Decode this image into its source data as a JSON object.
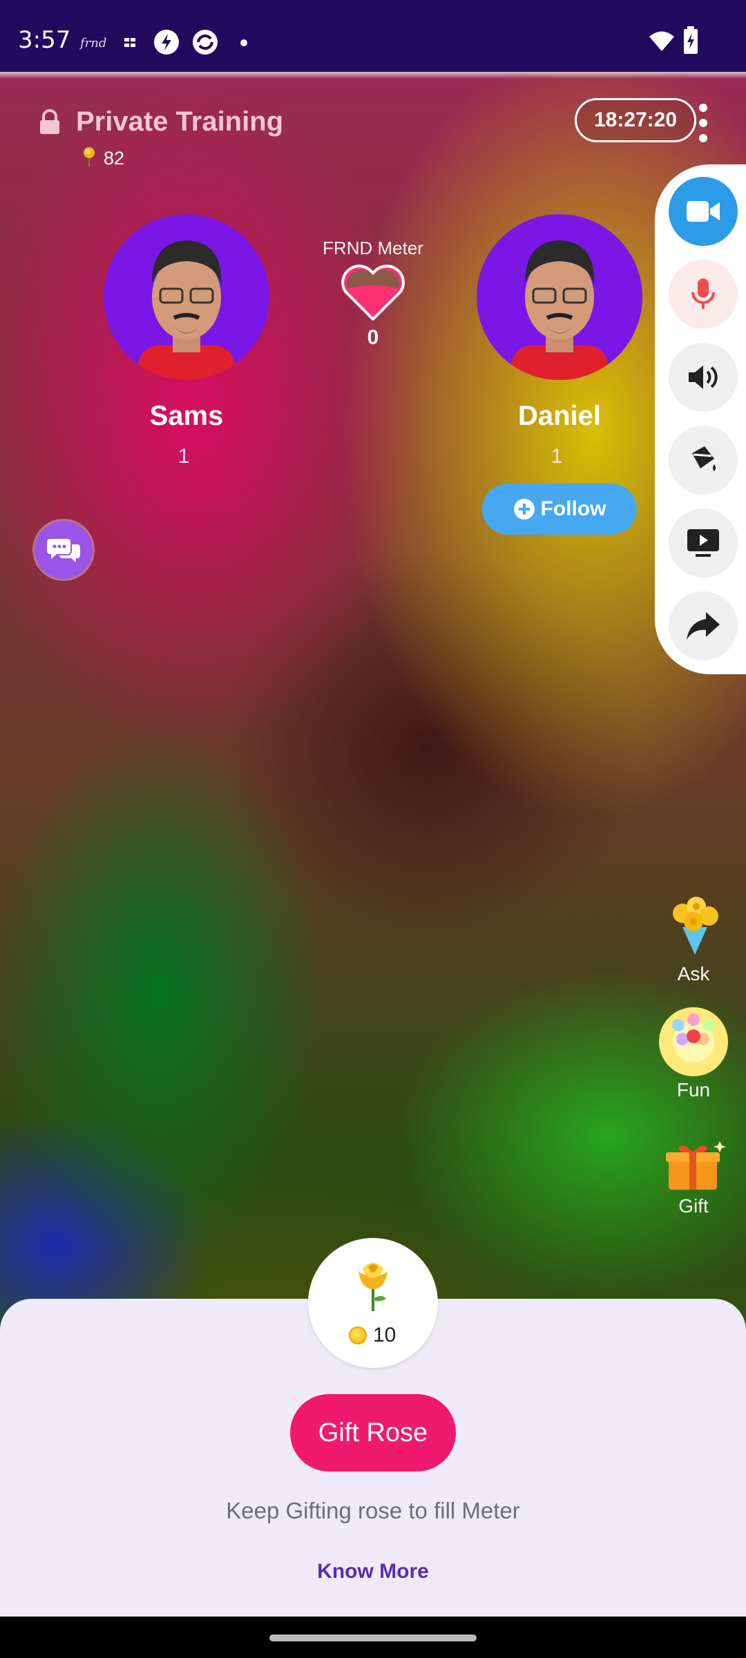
{
  "status_bar": {
    "time": "3:57",
    "app_glyph": "frnd"
  },
  "header": {
    "title": "Private Training",
    "rose_count": "82",
    "timer": "18:27:20"
  },
  "meter": {
    "label": "FRND Meter",
    "value": "0"
  },
  "hosts": [
    {
      "name": "Sams",
      "count": "1"
    },
    {
      "name": "Daniel",
      "count": "1"
    }
  ],
  "follow": {
    "label": "Follow"
  },
  "side_toolbar": [
    "video-icon",
    "mic-icon",
    "speaker-icon",
    "paint-bucket-icon",
    "screen-share-icon",
    "share-icon"
  ],
  "side_actions": {
    "ask": "Ask",
    "fun": "Fun",
    "gift": "Gift"
  },
  "gift_sheet": {
    "price": "10",
    "button": "Gift Rose",
    "hint": "Keep Gifting rose to fill Meter",
    "link": "Know More"
  },
  "colors": {
    "status_bar": "#210b5e",
    "accent_pink": "#ef1a6b",
    "follow_blue": "#45a8f1",
    "avatar_purple": "#7a17e6",
    "link_purple": "#5a2db0"
  }
}
